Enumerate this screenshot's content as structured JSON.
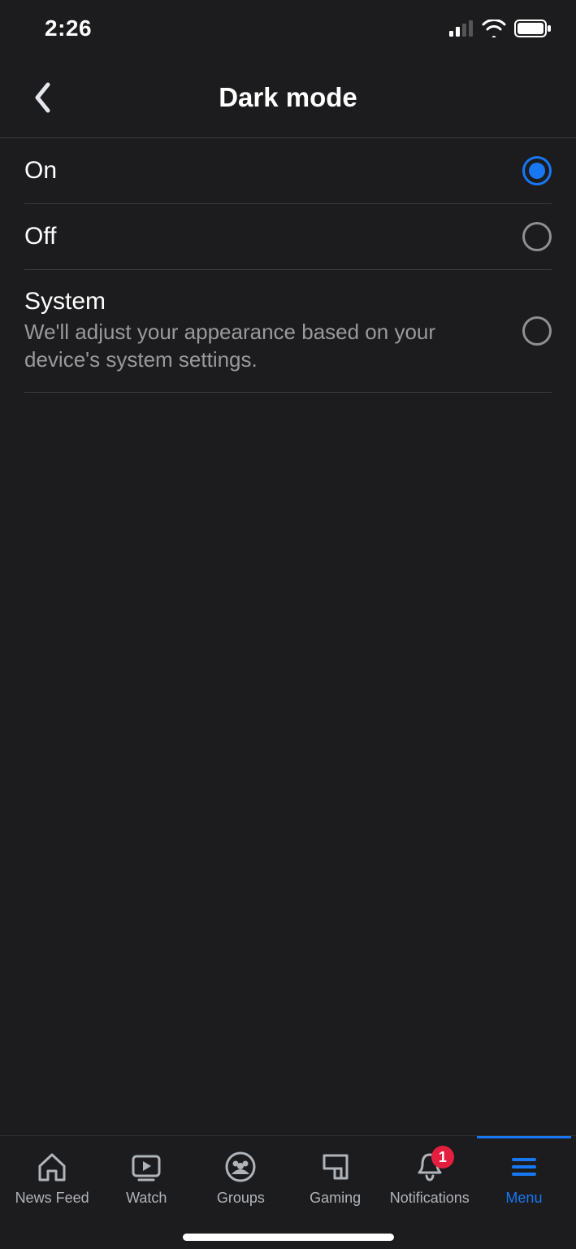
{
  "status": {
    "time": "2:26"
  },
  "header": {
    "title": "Dark mode"
  },
  "options": [
    {
      "label": "On",
      "desc": "",
      "selected": true
    },
    {
      "label": "Off",
      "desc": "",
      "selected": false
    },
    {
      "label": "System",
      "desc": "We'll adjust your appearance based on your device's system settings.",
      "selected": false
    }
  ],
  "tabs": {
    "newsfeed": {
      "label": "News Feed"
    },
    "watch": {
      "label": "Watch"
    },
    "groups": {
      "label": "Groups"
    },
    "gaming": {
      "label": "Gaming"
    },
    "notifications": {
      "label": "Notifications",
      "badge": "1"
    },
    "menu": {
      "label": "Menu"
    }
  }
}
